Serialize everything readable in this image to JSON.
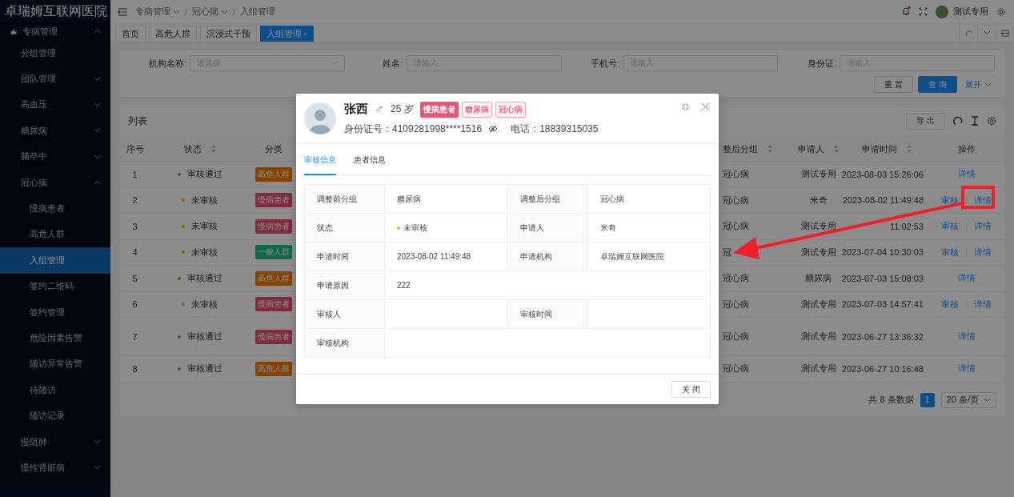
{
  "sidebar": {
    "logo": "卓瑞姆互联网医院",
    "items": [
      {
        "label": "专病管理",
        "expanded": true,
        "selected": false,
        "children": [
          {
            "label": "分组管理",
            "selected": false
          },
          {
            "label": "团队管理",
            "expanded": false,
            "selected": false
          },
          {
            "label": "高血压",
            "expanded": false,
            "selected": false
          },
          {
            "label": "糖尿病",
            "expanded": false,
            "selected": false
          },
          {
            "label": "脑卒中",
            "expanded": false,
            "selected": false
          },
          {
            "label": "冠心病",
            "expanded": true,
            "selected": false,
            "children": [
              {
                "label": "慢病患者",
                "selected": false
              },
              {
                "label": "高危人群",
                "selected": false
              },
              {
                "label": "入组管理",
                "selected": true
              },
              {
                "label": "签约二维码",
                "selected": false
              },
              {
                "label": "签约管理",
                "selected": false
              },
              {
                "label": "危险因素告警",
                "selected": false
              },
              {
                "label": "随访异常告警",
                "selected": false
              },
              {
                "label": "待随访",
                "selected": false
              },
              {
                "label": "随访记录",
                "selected": false
              }
            ]
          },
          {
            "label": "慢阻肺",
            "expanded": false,
            "selected": false
          },
          {
            "label": "慢性肾脏病",
            "expanded": false,
            "selected": false
          }
        ]
      }
    ]
  },
  "header": {
    "separator": "/",
    "breadcrumbs": [
      {
        "label": "专病管理",
        "dropdown": true
      },
      {
        "label": "冠心病",
        "dropdown": true
      },
      {
        "label": "入组管理",
        "dropdown": false
      }
    ],
    "user": "测试专用",
    "has_notification": true
  },
  "tabs": [
    {
      "label": "首页",
      "selected": false,
      "closable": false
    },
    {
      "label": "高危人群",
      "selected": false,
      "closable": false
    },
    {
      "label": "沉浸式干预",
      "selected": false,
      "closable": false
    },
    {
      "label": "入组管理",
      "selected": true,
      "closable": true,
      "close": "×"
    }
  ],
  "filters": [
    {
      "label": "机构名称:",
      "placeholder": "请选择",
      "kind": "select"
    },
    {
      "label": "姓名:",
      "placeholder": "请输入",
      "kind": "input"
    },
    {
      "label": "手机号:",
      "placeholder": "请输入",
      "kind": "input"
    },
    {
      "label": "身份证:",
      "placeholder": "请输入",
      "kind": "input"
    }
  ],
  "filter_buttons": {
    "reset": "重 置",
    "search": "查 询",
    "expand": "展开"
  },
  "list": {
    "title": "列表",
    "export": "导 出",
    "columns": [
      {
        "label": "序号",
        "sortable": false
      },
      {
        "label": "状态",
        "sortable": true
      },
      {
        "label": "分类",
        "sortable": false
      },
      {
        "label": "整后分组",
        "sortable": true
      },
      {
        "label": "申请人",
        "sortable": true
      },
      {
        "label": "申请时间",
        "sortable": true
      },
      {
        "label": "操作",
        "sortable": false
      }
    ],
    "rows": [
      {
        "index": "1",
        "status": {
          "text": "审核通过",
          "color": "#2d6c0e"
        },
        "category": {
          "text": "高危人群",
          "color": "#844400"
        },
        "group_after": "冠心病",
        "applicant": "测试专用",
        "time": "2023-08-03 15:26:06",
        "actions": [
          "详情"
        ]
      },
      {
        "index": "2",
        "status": {
          "text": "未审核",
          "color": "#895f0b"
        },
        "category": {
          "text": "慢病患者",
          "color": "#7f2c3c"
        },
        "group_after": "冠心病",
        "applicant": "米奇",
        "time": "2023-08-02 11:49:48",
        "actions": [
          "审核",
          "详情"
        ]
      },
      {
        "index": "3",
        "status": {
          "text": "未审核",
          "color": "#895f0b"
        },
        "category": {
          "text": "慢病患者",
          "color": "#7f2c3c"
        },
        "group_after": "冠心病",
        "applicant": "测试专用",
        "time": "11:02:53",
        "actions": [
          "审核",
          "详情"
        ]
      },
      {
        "index": "4",
        "status": {
          "text": "未审核",
          "color": "#895f0b"
        },
        "category": {
          "text": "一般人群",
          "color": "#0f694c"
        },
        "group_after": "冠",
        "applicant": "测试专用",
        "time": "2023-07-04 10:30:03",
        "actions": [
          "审核",
          "详情"
        ]
      },
      {
        "index": "5",
        "status": {
          "text": "审核通过",
          "color": "#2d6c0e"
        },
        "category": {
          "text": "高危人群",
          "color": "#844400"
        },
        "group_after": "冠心病",
        "applicant": "糖尿病",
        "time": "2023-07-03 15:08:03",
        "actions": [
          "详情"
        ]
      },
      {
        "index": "6",
        "status": {
          "text": "未审核",
          "color": "#895f0b"
        },
        "category": {
          "text": "慢病患者",
          "color": "#7f2c3c"
        },
        "group_after": "冠心病",
        "applicant": "测试专用",
        "time": "2023-07-03 14:57:41",
        "actions": [
          "审核",
          "详情"
        ]
      },
      {
        "index": "7",
        "status": {
          "text": "审核通过",
          "color": "#2d6c0e"
        },
        "category": {
          "text": "慢病患者",
          "color": "#7f2c3c"
        },
        "group_after": "冠心病",
        "applicant": "测试专用",
        "time": "2023-06-27 13:36:32",
        "actions": [
          "详情"
        ]
      },
      {
        "index": "8",
        "status": {
          "text": "审核通过",
          "color": "#2d6c0e"
        },
        "category": {
          "text": "高危人群",
          "color": "#844400"
        },
        "group_after": "冠心病",
        "applicant": "测试专用",
        "time": "2023-06-27 10:16:48",
        "actions": [
          "详情"
        ]
      }
    ],
    "total": "共 8 条数据",
    "pages": [
      {
        "label": "1",
        "selected": true
      }
    ],
    "page_size": "20 条/页"
  },
  "dialog": {
    "name": "张西",
    "gender": "♂",
    "age": "25 岁",
    "tags": [
      {
        "label": "慢病患者",
        "kind": "solid"
      },
      {
        "label": "糖尿病",
        "kind": "outline"
      },
      {
        "label": "冠心病",
        "kind": "outline"
      }
    ],
    "id_number": "身份证号：4109281998****1516",
    "phone": "电话：18839315035",
    "tabs": [
      {
        "label": "审核信息",
        "selected": true
      },
      {
        "label": "患者信息",
        "selected": false
      }
    ],
    "details": [
      [
        {
          "label": "调整前分组",
          "value": "糖尿病"
        },
        {
          "label": "调整后分组",
          "value": "冠心病"
        }
      ],
      [
        {
          "label": "状态",
          "value": "未审核",
          "color": "#faad14"
        },
        {
          "label": "申请人",
          "value": "米奇"
        }
      ],
      [
        {
          "label": "申请时间",
          "value": "2023-08-02 11:49:48"
        },
        {
          "label": "申请机构",
          "value": "卓瑞姆互联网医院"
        }
      ],
      [
        {
          "label": "申请原因",
          "value": "222"
        }
      ],
      [
        {
          "label": "审核人"
        },
        {
          "label": "审核时间"
        }
      ],
      [
        {
          "label": "审核机构"
        }
      ]
    ],
    "close_button": "关 闭"
  }
}
